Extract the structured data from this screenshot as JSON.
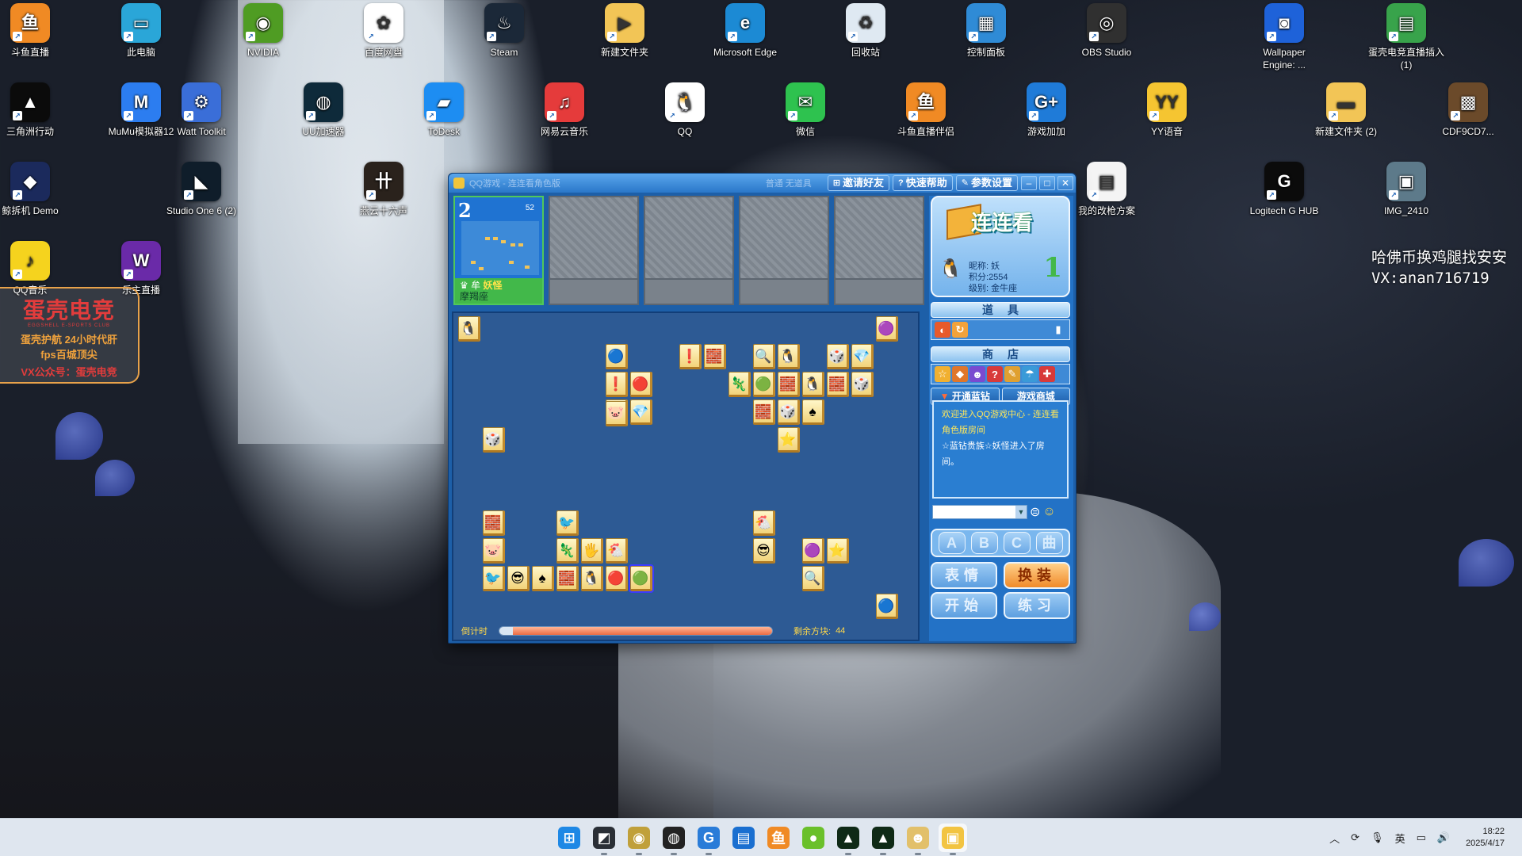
{
  "desktop": {
    "icons": [
      {
        "label": "斗鱼直播",
        "color": "#f08a24",
        "glyph": "鱼"
      },
      {
        "label": "此电脑",
        "color": "#2aa6d8",
        "glyph": "▭"
      },
      {
        "label": "NVIDIA",
        "color": "#4f9c23",
        "glyph": "◉"
      },
      {
        "label": "百度网盘",
        "color": "#ffffff",
        "glyph": "✿"
      },
      {
        "label": "Steam",
        "color": "#1b2838",
        "glyph": "♨"
      },
      {
        "label": "新建文件夹",
        "color": "#f2c556",
        "glyph": "▶"
      },
      {
        "label": "Microsoft Edge",
        "color": "#1c8ad4",
        "glyph": "e"
      },
      {
        "label": "回收站",
        "color": "#dfe9f2",
        "glyph": "♻"
      },
      {
        "label": "控制面板",
        "color": "#2f8bd6",
        "glyph": "▦"
      },
      {
        "label": "OBS Studio",
        "color": "#303030",
        "glyph": "◎"
      },
      {
        "label": "Wallpaper Engine: ...",
        "color": "#1e62d9",
        "glyph": "◙"
      },
      {
        "label": "蛋壳电竞直播插入(1)",
        "color": "#38a34b",
        "glyph": "▤"
      },
      {
        "label": "三角洲行动",
        "color": "#0b0b0b",
        "glyph": "▲"
      },
      {
        "label": "MuMu模拟器12",
        "color": "#2c7df0",
        "glyph": "M"
      },
      {
        "label": "Watt Toolkit",
        "color": "#3a6ed8",
        "glyph": "⚙"
      },
      {
        "label": "UU加速器",
        "color": "#0e2a3a",
        "glyph": "◍"
      },
      {
        "label": "ToDesk",
        "color": "#1d8df2",
        "glyph": "▰"
      },
      {
        "label": "网易云音乐",
        "color": "#e53b3b",
        "glyph": "♫"
      },
      {
        "label": "QQ",
        "color": "#ffffff",
        "glyph": "🐧"
      },
      {
        "label": "微信",
        "color": "#2ec24f",
        "glyph": "✉"
      },
      {
        "label": "斗鱼直播伴侣",
        "color": "#f08a24",
        "glyph": "鱼"
      },
      {
        "label": "游戏加加",
        "color": "#1f7bd8",
        "glyph": "G+"
      },
      {
        "label": "YY语音",
        "color": "#f5c531",
        "glyph": "YY"
      },
      {
        "label": "新建文件夹 (2)",
        "color": "#f2c556",
        "glyph": "▬"
      },
      {
        "label": "CDF9CD7...",
        "color": "#6b4a2a",
        "glyph": "▩"
      },
      {
        "label": "鲸拆机 Demo",
        "color": "#1b2a5c",
        "glyph": "◆"
      },
      {
        "label": "Studio One 6 (2)",
        "color": "#0f1d2a",
        "glyph": "◣"
      },
      {
        "label": "燕云十六声",
        "color": "#2a221c",
        "glyph": "卄"
      },
      {
        "label": "我的改枪方案",
        "color": "#f4f4f4",
        "glyph": "▤"
      },
      {
        "label": "Logitech G HUB",
        "color": "#0b0b0b",
        "glyph": "G"
      },
      {
        "label": "IMG_2410",
        "color": "#5d7a8a",
        "glyph": "▣"
      },
      {
        "label": "QQ音乐",
        "color": "#f5d31e",
        "glyph": "♪"
      },
      {
        "label": "乐主直播",
        "color": "#6a2aa8",
        "glyph": "W"
      }
    ],
    "ad": {
      "brand": "蛋壳电竞",
      "brand_en": "EGGSHELL E-SPORTS CLUB",
      "line1": "蛋壳护航 24小时代肝",
      "line2": "fps百城顶尖",
      "line3": "VX公众号：蛋壳电竞"
    },
    "watermark": {
      "line1": "哈佛币换鸡腿找安安",
      "line2": "VX:anan716719"
    }
  },
  "game_window": {
    "title": "QQ游戏 - 连连看角色版",
    "mode": "普通 无道具",
    "buttons": {
      "invite": "邀请好友",
      "help": "快速帮助",
      "settings": "参数设置"
    },
    "seat": {
      "number": "2",
      "score": "52",
      "nickname": "妖怪",
      "location": "摩羯座"
    },
    "player": {
      "nickname_label": "昵称:",
      "nickname": "妖",
      "score_label": "积分:",
      "score": "2554",
      "rank_label": "级别:",
      "rank": "金牛座",
      "level": "1"
    },
    "logo_text": "连连看",
    "props_header": "道具",
    "shop_header": "商店",
    "shop_buttons": {
      "vip": "开通蓝钻",
      "mall": "游戏商城"
    },
    "chat": {
      "line1": "欢迎进入QQ游戏中心 - 连连看角色版房间",
      "line2": "☆蓝钻贵族☆妖怪进入了房间。"
    },
    "abc": [
      "A",
      "B",
      "C",
      "曲"
    ],
    "actions": {
      "emote": "表情",
      "dress": "换装",
      "start": "开始",
      "practice": "练习"
    },
    "timer_label": "倒计时",
    "timer_remaining": 0.95,
    "remaining_label": "剩余方块:",
    "remaining": "44"
  },
  "board_tiles": [
    "🐧",
    "🔵",
    "❗",
    "🔴",
    "🐷",
    "💎",
    "❗",
    "🧱",
    "🔍",
    "🐧",
    "🦎",
    "🟢",
    "🧱",
    "🐧",
    "🧱",
    "🎲",
    "💎",
    "🎲",
    "🧱",
    "🎲",
    "♠",
    "🐷",
    "⭐",
    "🎲",
    "🧱",
    "🐦",
    "🐷",
    "🦎",
    "🖐",
    "🐔",
    "🐦",
    "😎",
    "♠",
    "🧱",
    "🐧",
    "🔴",
    "🟢",
    "🐔",
    "😎",
    "🟣",
    "⭐",
    "🔍",
    "🔵",
    "🟣"
  ],
  "taskbar": {
    "icons": [
      {
        "name": "start-icon",
        "glyph": "⊞",
        "color": "#1e88e5",
        "run": false
      },
      {
        "name": "ide-icon",
        "glyph": "◩",
        "color": "#2a2f36",
        "run": true
      },
      {
        "name": "owl-icon",
        "glyph": "◉",
        "color": "#c0a03a",
        "run": true
      },
      {
        "name": "chrome-icon",
        "glyph": "◍",
        "color": "#222222",
        "run": true
      },
      {
        "name": "game-plus-icon",
        "glyph": "G",
        "color": "#2a7cd8",
        "run": true
      },
      {
        "name": "notes-icon",
        "glyph": "▤",
        "color": "#1a6fd0",
        "run": false
      },
      {
        "name": "douyu-icon",
        "glyph": "鱼",
        "color": "#f08a24",
        "run": false
      },
      {
        "name": "ball-icon",
        "glyph": "●",
        "color": "#6ac02a",
        "run": false
      },
      {
        "name": "delta-icon",
        "glyph": "▲",
        "color": "#0f2a16",
        "run": true
      },
      {
        "name": "delta2-icon",
        "glyph": "▲",
        "color": "#0f2a16",
        "run": true
      },
      {
        "name": "mascot-icon",
        "glyph": "☻",
        "color": "#e2c06a",
        "run": true
      },
      {
        "name": "qqgame-icon",
        "glyph": "▣",
        "color": "#f2c442",
        "run": true,
        "active": true
      }
    ],
    "ime": "英",
    "time": "18:22",
    "date": "2025/4/17"
  },
  "colors": {
    "window": "#1d5fa8",
    "board": "#2d5a94",
    "tile": "#f2d37a",
    "accent": "#f1c53c"
  }
}
